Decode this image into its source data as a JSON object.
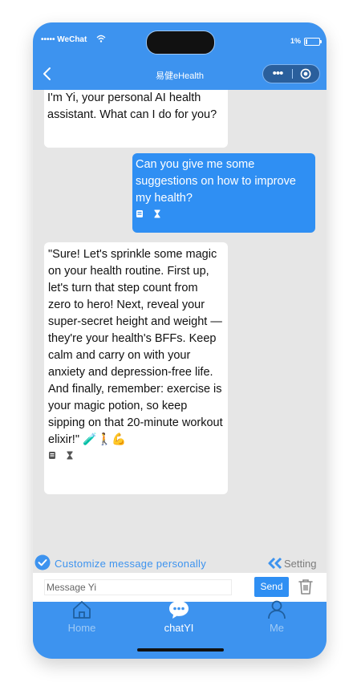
{
  "status_bar": {
    "carrier": "••••• WeChat",
    "battery": "1%"
  },
  "nav": {
    "title": "易健eHealth",
    "more_label": "•••"
  },
  "messages": [
    {
      "role": "bot",
      "text": "I'm Yi, your personal AI health assistant. What can I do for you?"
    },
    {
      "role": "user",
      "text": "Can you give me some suggestions on how to improve my health?"
    },
    {
      "role": "bot",
      "text": "\"Sure! Let's sprinkle some magic on your health routine. First up, let's turn that step count from zero to hero! Next, reveal your super-secret height and weight — they're your health's BFFs. Keep calm and carry on with your anxiety and depression-free life. And finally, remember: exercise is your magic potion, so keep sipping on that 20-minute workout elixir!\" 🧪🚶💪"
    }
  ],
  "customize": {
    "label": "Customize message personally",
    "setting_label": "Setting"
  },
  "composer": {
    "placeholder": "Message Yi",
    "send_label": "Send"
  },
  "tabs": [
    {
      "label": "Home",
      "icon": "home-icon"
    },
    {
      "label": "chatYI",
      "icon": "chat-bubble-icon",
      "active": true
    },
    {
      "label": "Me",
      "icon": "user-icon"
    }
  ],
  "colors": {
    "primary": "#3d93ef",
    "user_bubble": "#2f8ff3",
    "background": "#e6e6e6"
  }
}
